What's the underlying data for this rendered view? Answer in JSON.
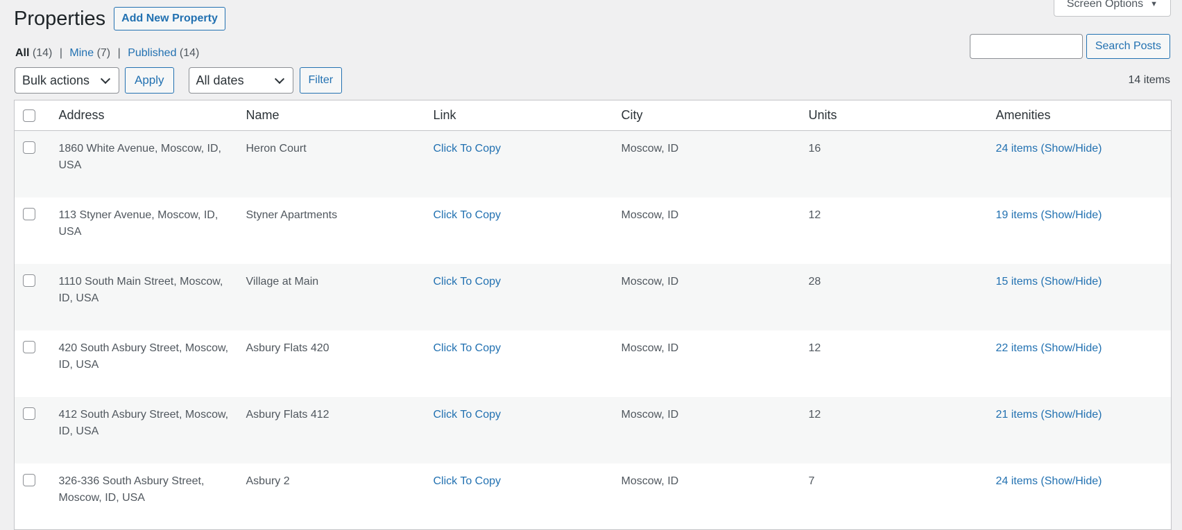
{
  "screen_options": {
    "label": "Screen Options",
    "arrow": "▼"
  },
  "page": {
    "title": "Properties",
    "add_new_label": "Add New Property"
  },
  "views": [
    {
      "label": "All",
      "count": "(14)",
      "current": true
    },
    {
      "label": "Mine",
      "count": "(7)",
      "current": false
    },
    {
      "label": "Published",
      "count": "(14)",
      "current": false
    }
  ],
  "views_separator": "|",
  "search": {
    "value": "",
    "button_label": "Search Posts"
  },
  "tablenav": {
    "bulk_actions": "Bulk actions",
    "apply_label": "Apply",
    "dates": "All dates",
    "filter_label": "Filter",
    "items_count": "14 items"
  },
  "table": {
    "columns": [
      "Address",
      "Name",
      "Link",
      "City",
      "Units",
      "Amenities"
    ],
    "rows": [
      {
        "address": "1860 White Avenue, Moscow, ID, USA",
        "name": "Heron Court",
        "link": "Click To Copy",
        "city": "Moscow, ID",
        "units": "16",
        "amenities": "24 items (Show/Hide)"
      },
      {
        "address": "113 Styner Avenue, Moscow, ID, USA",
        "name": "Styner Apartments",
        "link": "Click To Copy",
        "city": "Moscow, ID",
        "units": "12",
        "amenities": "19 items (Show/Hide)"
      },
      {
        "address": "1110 South Main Street, Moscow, ID, USA",
        "name": "Village at Main",
        "link": "Click To Copy",
        "city": "Moscow, ID",
        "units": "28",
        "amenities": "15 items (Show/Hide)"
      },
      {
        "address": "420 South Asbury Street, Moscow, ID, USA",
        "name": "Asbury Flats 420",
        "link": "Click To Copy",
        "city": "Moscow, ID",
        "units": "12",
        "amenities": "22 items (Show/Hide)"
      },
      {
        "address": "412 South Asbury Street, Moscow, ID, USA",
        "name": "Asbury Flats 412",
        "link": "Click To Copy",
        "city": "Moscow, ID",
        "units": "12",
        "amenities": "21 items (Show/Hide)"
      },
      {
        "address": "326-336 South Asbury Street, Moscow, ID, USA",
        "name": "Asbury 2",
        "link": "Click To Copy",
        "city": "Moscow, ID",
        "units": "7",
        "amenities": "24 items (Show/Hide)"
      }
    ]
  },
  "colors": {
    "link": "#2271b1",
    "background": "#f0f0f1",
    "row_alt": "#f6f7f7"
  }
}
